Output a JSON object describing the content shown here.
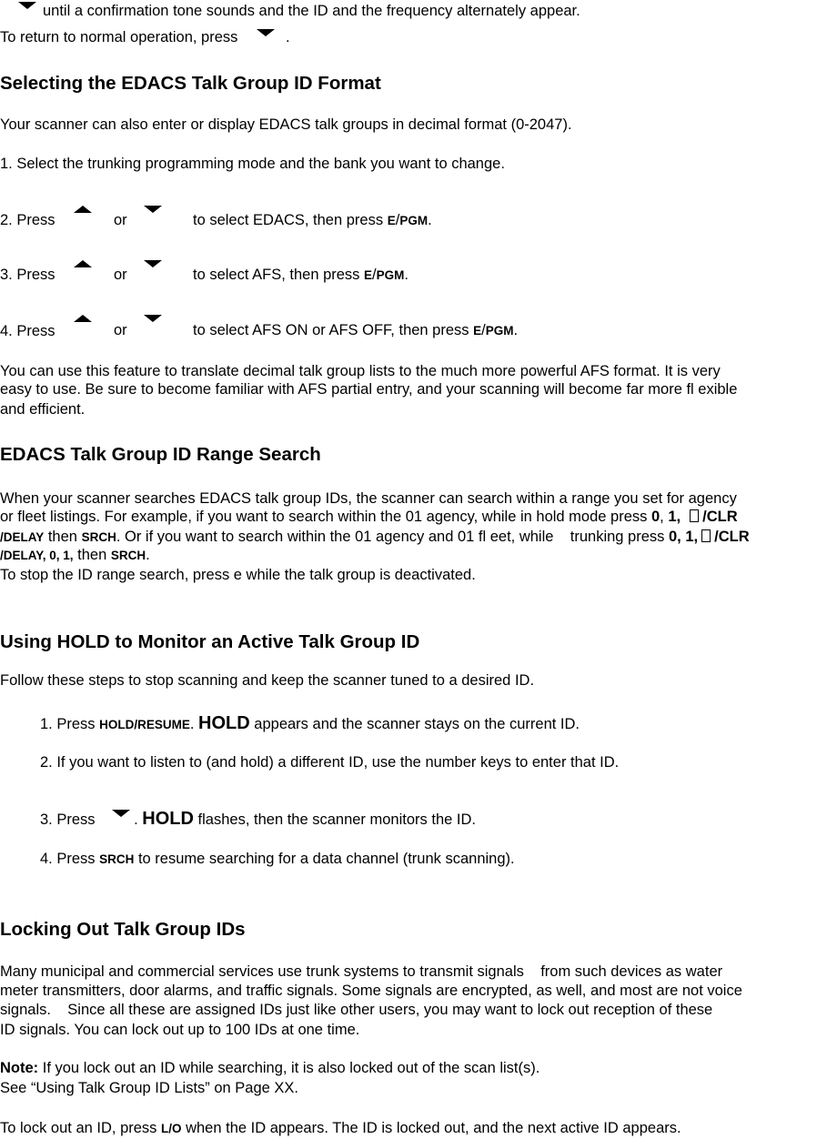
{
  "intro": {
    "line1_text": "until a confirmation tone sounds and the ID and the frequency alternately appear.",
    "line2_text": "To return to normal operation, press",
    "line2_end": "."
  },
  "section_format": {
    "heading": "Selecting the EDACS Talk Group ID Format",
    "para": "Your scanner can also enter or display EDACS talk groups in decimal format (0-2047).",
    "step1": "1. Select the trunking programming mode and the bank you want to change.",
    "steps": [
      {
        "prefix": "2. Press",
        "or": "or",
        "text": "to select EDACS, then press",
        "key_e": "E",
        "key_sep": "/",
        "key_pgm": "PGM",
        "end": "."
      },
      {
        "prefix": "3. Press",
        "or": "or",
        "text": "to select AFS, then press",
        "key_e": "E",
        "key_sep": "/",
        "key_pgm": "PGM",
        "end": "."
      },
      {
        "prefix": "4. Press",
        "or": "or",
        "text": "to select AFS ON or AFS OFF, then press",
        "key_e": "E",
        "key_sep": "/",
        "key_pgm": "PGM",
        "end": "."
      }
    ],
    "para2_lines": [
      "You can use this feature to translate decimal talk group lists to the much more powerful AFS format. It is very",
      "easy to use. Be sure to become familiar with AFS partial entry, and your scanning will become far more fl exible",
      "and efficient."
    ]
  },
  "section_range": {
    "heading": "EDACS Talk Group ID Range Search",
    "line1": "When your scanner searches EDACS talk group IDs, the scanner can search within a range you set for agency",
    "line2_text": "or fleet listings. For example, if you want to search within the 01 agency, while in hold mode press ",
    "line2_k0": "0",
    "line2_comma": ", ",
    "line2_k1": "1,",
    "line2_clr": "/CLR",
    "line3_delay": "/DELAY",
    "line3_then": " then ",
    "line3_srch": "SRCH",
    "line3_text": ". Or if you want to search within the 01 agency and 01 fl eet, while    trunking press ",
    "line3_keys": "0, 1,",
    "line3_clr": "/CLR",
    "line4_keys": "/DELAY, 0, 1,",
    "line4_then": " then ",
    "line4_srch": "SRCH",
    "line4_end": ".",
    "line5": "To stop the ID range search, press e while the talk group is deactivated."
  },
  "section_hold": {
    "heading": "Using HOLD to Monitor an Active Talk Group ID",
    "para": "Follow these steps to stop scanning and keep the scanner tuned to a desired ID.",
    "step1_prefix": "1. Press ",
    "step1_key": "HOLD/RESUME",
    "step1_dot": ". ",
    "step1_hold": "HOLD",
    "step1_text": " appears and the scanner stays on the current ID.",
    "step2": "2. If you want to listen to (and hold) a different ID, use the number keys to enter that ID.",
    "step3_prefix": "3. Press",
    "step3_dot": ". ",
    "step3_hold": "HOLD",
    "step3_text": " flashes, then the scanner monitors the ID.",
    "step4_prefix": "4. Press ",
    "step4_key": "SRCH",
    "step4_text": " to resume searching for a data channel (trunk scanning)."
  },
  "section_lockout": {
    "heading": "Locking Out Talk Group IDs",
    "para_lines": [
      "Many municipal and commercial services use trunk systems to transmit signals    from such devices as water",
      "meter transmitters, door alarms, and traffic signals. Some signals are encrypted, as well, and most are not voice",
      "signals.    Since all these are assigned IDs just like other users, you may want to lock out reception of these",
      "ID signals. You can lock out up to 100 IDs at one time."
    ],
    "note_label": "Note:",
    "note_text": " If you lock out an ID while searching, it is also locked out of the scan list(s).",
    "see_text": "See “Using Talk Group ID Lists” on Page XX.",
    "final_prefix": "To lock out an ID, press ",
    "final_key": "L/O",
    "final_text": " when the ID appears. The ID is locked out, and the next active ID appears."
  }
}
